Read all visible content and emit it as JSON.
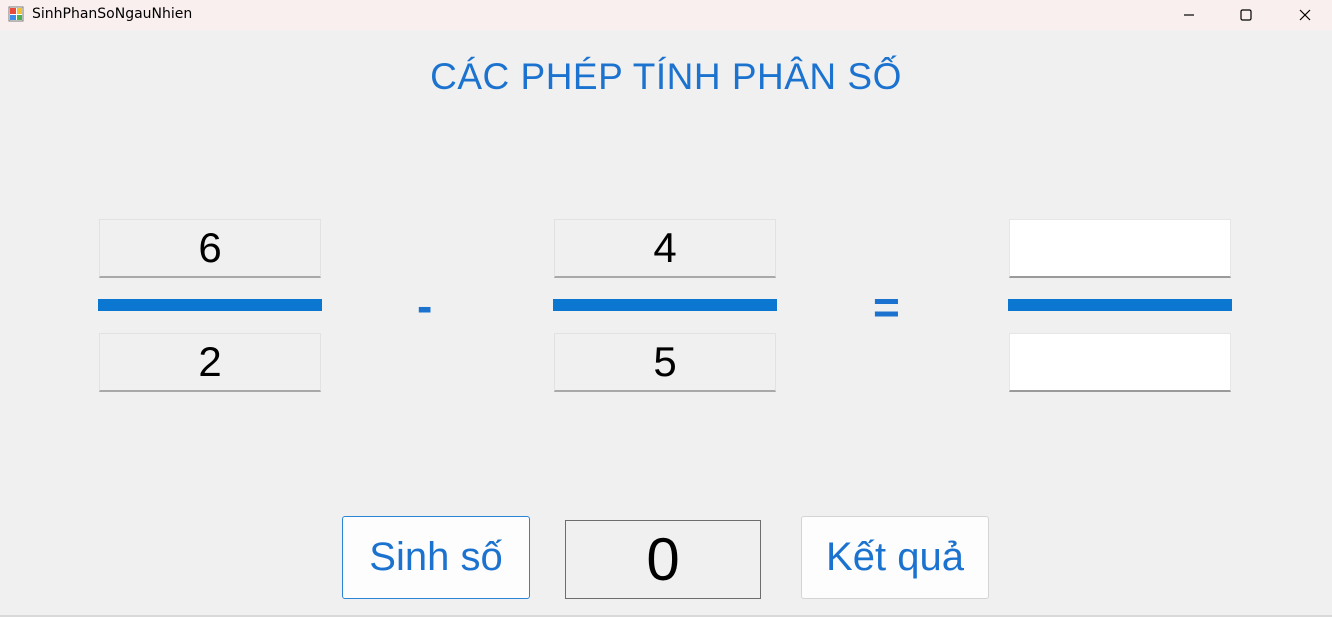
{
  "window": {
    "title": "SinhPhanSoNgauNhien",
    "app_icon": "winforms-app-icon",
    "controls": {
      "minimize_icon": "minimize-icon",
      "maximize_icon": "maximize-icon",
      "close_icon": "close-icon"
    },
    "titlebar_color": "#f9efee"
  },
  "heading": "CÁC PHÉP TÍNH PHÂN SỐ",
  "fraction_a": {
    "numerator": "6",
    "denominator": "2"
  },
  "operator": "-",
  "fraction_b": {
    "numerator": "4",
    "denominator": "5"
  },
  "equals": "=",
  "result": {
    "numerator": "",
    "denominator": ""
  },
  "buttons": {
    "generate_label": "Sinh số",
    "result_label": "Kết quả"
  },
  "counter": "0",
  "colors": {
    "accent": "#1c73cf",
    "fraction_bar": "#0b77d0",
    "background": "#f0f0f0"
  }
}
